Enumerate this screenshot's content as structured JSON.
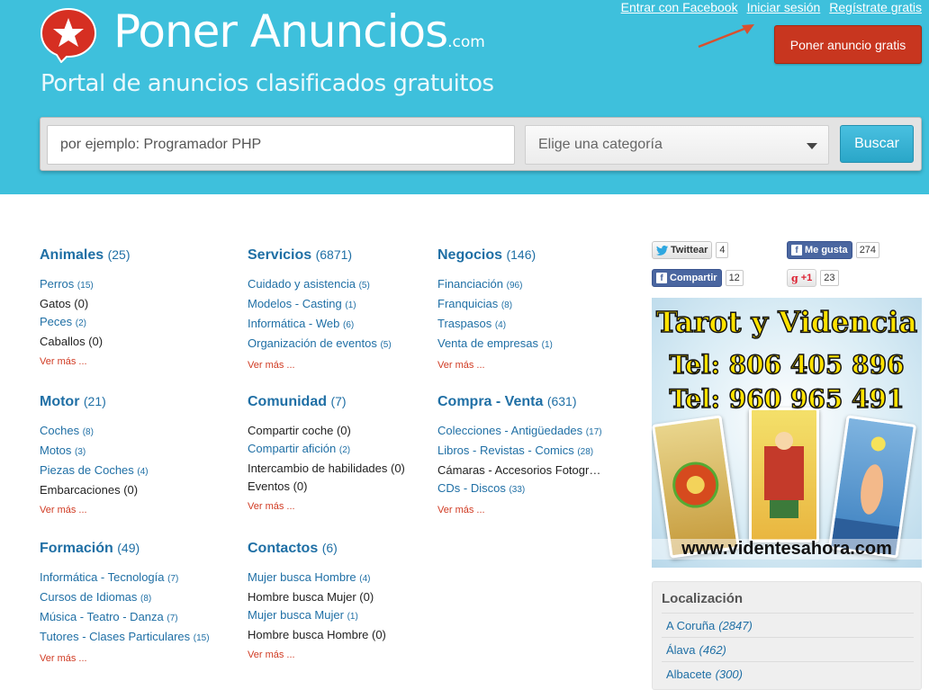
{
  "header": {
    "brand": "Poner Anuncios",
    "brand_tld": ".com",
    "tagline": "Portal de anuncios clasificados gratuitos",
    "links": [
      {
        "label": "Entrar con Facebook"
      },
      {
        "label": "Iniciar sesión"
      },
      {
        "label": "Regístrate gratis"
      }
    ],
    "cta": "Poner anuncio gratis"
  },
  "search": {
    "placeholder": "por ejemplo: Programador PHP",
    "category_placeholder": "Elige una categoría",
    "button": "Buscar"
  },
  "categories": [
    {
      "title": "Animales",
      "count": "(25)",
      "more": "Ver más ...",
      "items": [
        {
          "label": "Perros",
          "n": "(15)"
        },
        {
          "label": "Gatos (0)",
          "n": ""
        },
        {
          "label": "Peces",
          "n": "(2)"
        },
        {
          "label": "Caballos (0)",
          "n": ""
        }
      ]
    },
    {
      "title": "Servicios",
      "count": "(6871)",
      "more": "Ver más ...",
      "items": [
        {
          "label": "Cuidado y asistencia",
          "n": "(5)"
        },
        {
          "label": "Modelos - Casting",
          "n": "(1)"
        },
        {
          "label": "Informática - Web",
          "n": "(6)"
        },
        {
          "label": "Organización de eventos",
          "n": "(5)"
        }
      ]
    },
    {
      "title": "Negocios",
      "count": "(146)",
      "more": "Ver más ...",
      "items": [
        {
          "label": "Financiación",
          "n": "(96)"
        },
        {
          "label": "Franquicias",
          "n": "(8)"
        },
        {
          "label": "Traspasos",
          "n": "(4)"
        },
        {
          "label": "Venta de empresas",
          "n": "(1)"
        }
      ]
    },
    {
      "title": "Motor",
      "count": "(21)",
      "more": "Ver más ...",
      "items": [
        {
          "label": "Coches",
          "n": "(8)"
        },
        {
          "label": "Motos",
          "n": "(3)"
        },
        {
          "label": "Piezas de Coches",
          "n": "(4)"
        },
        {
          "label": "Embarcaciones (0)",
          "n": ""
        }
      ]
    },
    {
      "title": "Comunidad",
      "count": "(7)",
      "more": "Ver más ...",
      "items": [
        {
          "label": "Compartir coche (0)",
          "n": ""
        },
        {
          "label": "Compartir afición",
          "n": "(2)"
        },
        {
          "label": "Intercambio de habilidades (0)",
          "n": ""
        },
        {
          "label": "Eventos (0)",
          "n": ""
        }
      ]
    },
    {
      "title": "Compra - Venta",
      "count": "(631)",
      "more": "Ver más ...",
      "items": [
        {
          "label": "Colecciones - Antigüedades",
          "n": "(17)"
        },
        {
          "label": "Libros - Revistas - Comics",
          "n": "(28)"
        },
        {
          "label": "Cámaras - Accesorios Fotogr…",
          "n": ""
        },
        {
          "label": "CDs - Discos",
          "n": "(33)"
        }
      ]
    },
    {
      "title": "Formación",
      "count": "(49)",
      "more": "Ver más ...",
      "items": [
        {
          "label": "Informática - Tecnología",
          "n": "(7)"
        },
        {
          "label": "Cursos de Idiomas",
          "n": "(8)"
        },
        {
          "label": "Música - Teatro - Danza",
          "n": "(7)"
        },
        {
          "label": "Tutores - Clases Particulares",
          "n": "(15)"
        }
      ]
    },
    {
      "title": "Contactos",
      "count": "(6)",
      "more": "Ver más ...",
      "items": [
        {
          "label": "Mujer busca Hombre",
          "n": "(4)"
        },
        {
          "label": "Hombre busca Mujer (0)",
          "n": ""
        },
        {
          "label": "Mujer busca Mujer",
          "n": "(1)"
        },
        {
          "label": "Hombre busca Hombre (0)",
          "n": ""
        }
      ]
    }
  ],
  "social": {
    "twitter": {
      "label": "Twittear",
      "count": "4"
    },
    "fb_like": {
      "label": "Me gusta",
      "count": "274"
    },
    "fb_share": {
      "label": "Compartir",
      "count": "12"
    },
    "gplus": {
      "label": "+1",
      "count": "23"
    }
  },
  "ad": {
    "title": "Tarot y Videncia",
    "tel1": "Tel: 806 405 896",
    "tel2": "Tel: 960 965 491",
    "url": "www.videntesahora.com"
  },
  "localizacion": {
    "title": "Localización",
    "items": [
      {
        "label": "A Coruña",
        "n": "(2847)"
      },
      {
        "label": "Álava",
        "n": "(462)"
      },
      {
        "label": "Albacete",
        "n": "(300)"
      }
    ]
  },
  "colors": {
    "header_bg": "#3ec0dc",
    "link": "#1f6fa5",
    "cta": "#c8361f",
    "more": "#d03a22"
  }
}
